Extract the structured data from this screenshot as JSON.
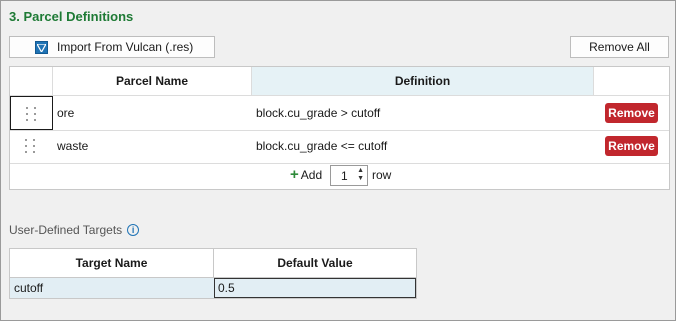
{
  "section": {
    "title": "3. Parcel Definitions"
  },
  "toolbar": {
    "import_label": "Import From Vulcan (.res)",
    "import_icon": "funnel-icon",
    "remove_all_label": "Remove All"
  },
  "parcels": {
    "columns": [
      "",
      "Parcel Name",
      "Definition",
      ""
    ],
    "rows": [
      {
        "name": "ore",
        "definition": "block.cu_grade > cutoff",
        "action": "Remove"
      },
      {
        "name": "waste",
        "definition": "block.cu_grade <= cutoff",
        "action": "Remove"
      }
    ],
    "add": {
      "label": "Add",
      "count": "1",
      "unit": "row"
    }
  },
  "targets": {
    "label": "User-Defined Targets",
    "info_icon": "info-icon",
    "columns": [
      "Target Name",
      "Default Value"
    ],
    "rows": [
      {
        "name": "cutoff",
        "value": "0.5"
      }
    ]
  },
  "colors": {
    "section_title": "#1e7a35",
    "remove_button": "#c1272d",
    "add_plus": "#2e8b3a",
    "selected_header": "#e6f2f6",
    "selected_row": "#e2eef4"
  }
}
